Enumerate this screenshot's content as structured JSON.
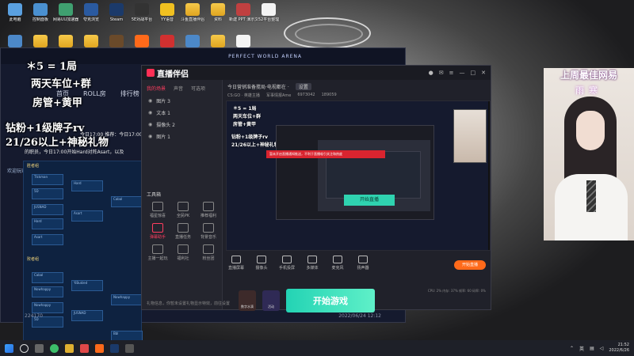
{
  "desktop": {
    "icons_row1": [
      "此电脑",
      "控制面板",
      "网易UU加速器",
      "夸克浏览",
      "Steam",
      "5E对战平台",
      "YY语音",
      "斗鱼直播伴侣",
      "资料",
      "新建 PPT 演示文稿",
      "52平台整理"
    ],
    "icons_row2": [
      "回收站",
      "",
      "新建文件夹",
      "",
      "完美世界竞技平台",
      "斗鱼直播伴侣",
      "机外-抖音",
      "51整理机器",
      "52",
      "52平台整理"
    ]
  },
  "stream_window": {
    "banner": "PERFECT WORLD ARENA",
    "tabs": [
      "首页",
      "ROLL房",
      "排行榜"
    ],
    "overlay_lines": [
      "＊5 = 1局",
      "两天车位+群",
      "房管+黄甲",
      "钻粉+1级牌子rv",
      "21/26以上+神秘礼物"
    ],
    "chat_line1": "今日17:00 推荐：今日17:00[精彩]",
    "chat_line2": "的职员，今日17:00开始Hard对阵Asart，以及",
    "welcome": "欢迎玩家 进入直播间",
    "bracket_heads": [
      "胜者组",
      "败者组"
    ],
    "teams": [
      "TIckman",
      "5D",
      "JUSNAD",
      "Hard",
      "Asart",
      "Hard",
      "Asart",
      "Cabal",
      "Cabal",
      "Nowhappy",
      "Nowhappy",
      "5D",
      "YiBukled",
      "JUSNAD",
      "Nowhappy",
      "Bbl"
    ],
    "footer_left": "224",
    "footer_mid": "170",
    "footer_date": "2022/06/24 12:12"
  },
  "companion": {
    "title": "直播伴侣",
    "scene_tabs": [
      "我的场景",
      "声音",
      "可选项"
    ],
    "sources": [
      "图片 3",
      "文本 1",
      "摄像头 2",
      "图片 1"
    ],
    "preview_title": "今日营销准备搅局·电视都在 · ",
    "preview_badge": "设置",
    "preview_meta": [
      "CS:GO · 英雄主播",
      "军事情报Ame",
      "6973042",
      "189059"
    ],
    "tools_title": "工具箱",
    "tools": [
      {
        "label": "福星惊喜",
        "hot": false
      },
      {
        "label": "全民PK",
        "hot": false
      },
      {
        "label": "推荐福利",
        "hot": false
      },
      {
        "label": "弹幕助手",
        "hot": true
      },
      {
        "label": "直播任务",
        "hot": false
      },
      {
        "label": "背景音乐",
        "hot": false
      },
      {
        "label": "主播一起玩",
        "hot": false
      },
      {
        "label": "福利社",
        "hot": false
      },
      {
        "label": "粉丝团",
        "hot": false
      }
    ],
    "status_text": "礼物信息，你暂未设置礼物显示特效，前往设置",
    "red_strip": "暂未开启直播通知推送，不利于直播吸引关注和热度",
    "nested_start": "开始直播",
    "dock": [
      "直播屏幕",
      "摄像头",
      "手机投屏",
      "多媒体",
      "麦克风",
      "扬声器"
    ],
    "live_button": "开始直播",
    "stats": "CPU: 2%   内存: 37%   帧率: 60   码率: 0%",
    "mini_tiles": [
      "数字水滴",
      "活动"
    ],
    "start_game": "开始游戏"
  },
  "webcam": {
    "title": "上周最佳网易",
    "name": "雨寒"
  },
  "taskbar": {
    "lang": "英",
    "time": "21:52",
    "date": "2022/6/26"
  }
}
